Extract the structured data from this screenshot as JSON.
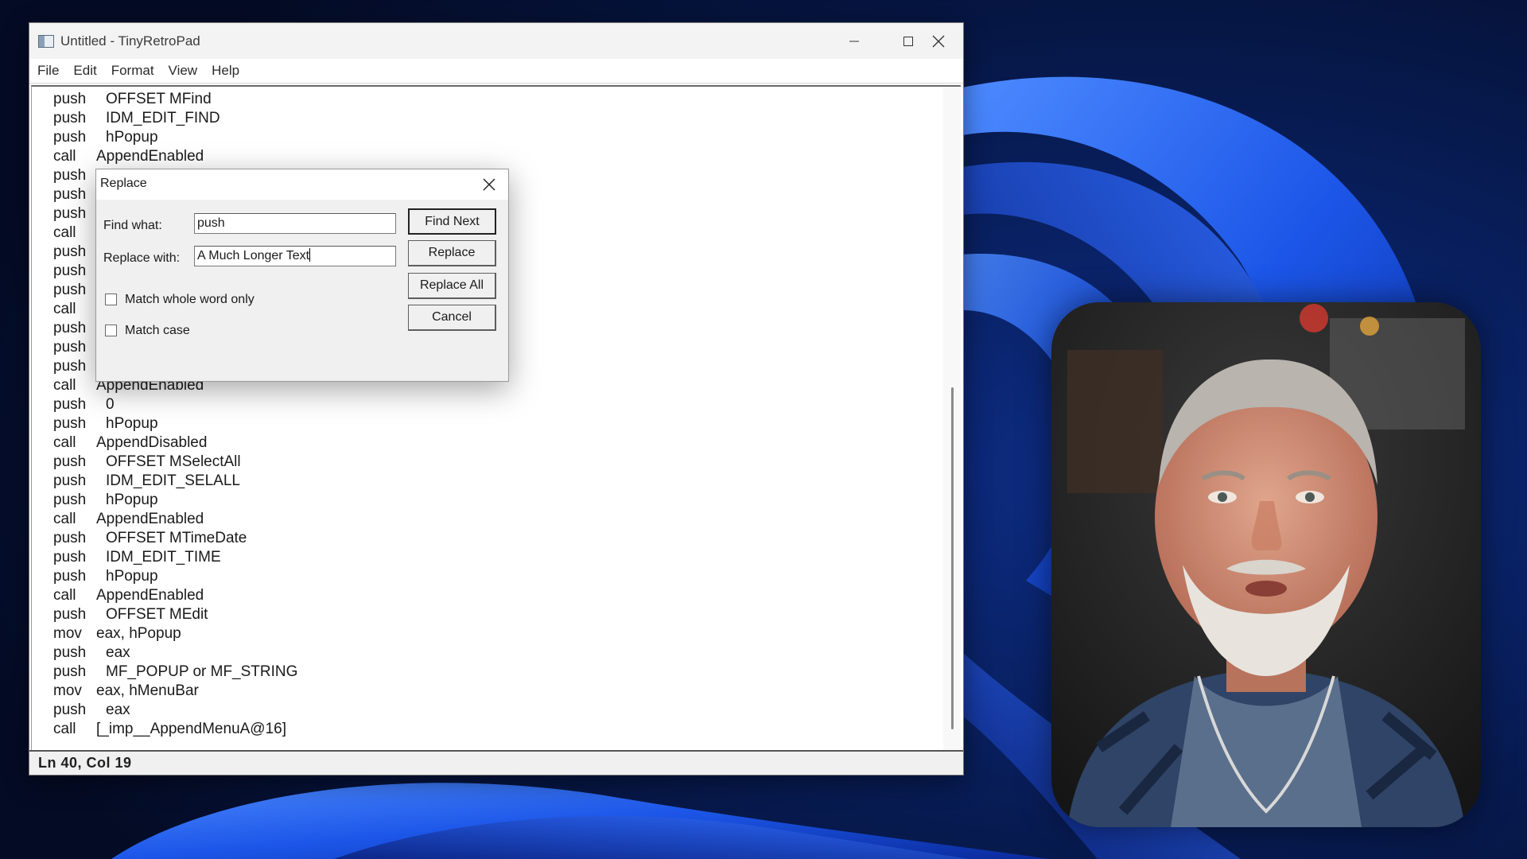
{
  "window": {
    "title": "Untitled - TinyRetroPad"
  },
  "menu": [
    "File",
    "Edit",
    "Format",
    "View",
    "Help"
  ],
  "editor": {
    "lines": [
      {
        "op": "push",
        "arg": "OFFSET MFind"
      },
      {
        "op": "push",
        "arg": "IDM_EDIT_FIND"
      },
      {
        "op": "push",
        "arg": "hPopup"
      },
      {
        "op": "call",
        "arg": "AppendEnabled"
      },
      {
        "op": "push",
        "arg": ""
      },
      {
        "op": "push",
        "arg": ""
      },
      {
        "op": "push",
        "arg": ""
      },
      {
        "op": "call",
        "arg": ""
      },
      {
        "op": "push",
        "arg": ""
      },
      {
        "op": "push",
        "arg": ""
      },
      {
        "op": "push",
        "arg": ""
      },
      {
        "op": "call",
        "arg": ""
      },
      {
        "op": "push",
        "arg": ""
      },
      {
        "op": "push",
        "arg": ""
      },
      {
        "op": "push",
        "arg": ""
      },
      {
        "op": "call",
        "arg": "AppendEnabled"
      },
      {
        "op": "push",
        "arg": "0"
      },
      {
        "op": "push",
        "arg": "hPopup"
      },
      {
        "op": "call",
        "arg": "AppendDisabled"
      },
      {
        "op": "push",
        "arg": "OFFSET MSelectAll"
      },
      {
        "op": "push",
        "arg": "IDM_EDIT_SELALL"
      },
      {
        "op": "push",
        "arg": "hPopup"
      },
      {
        "op": "call",
        "arg": "AppendEnabled"
      },
      {
        "op": "push",
        "arg": "OFFSET MTimeDate"
      },
      {
        "op": "push",
        "arg": "IDM_EDIT_TIME"
      },
      {
        "op": "push",
        "arg": "hPopup"
      },
      {
        "op": "call",
        "arg": "AppendEnabled"
      },
      {
        "op": "push",
        "arg": "OFFSET MEdit"
      },
      {
        "op": "mov",
        "arg": "eax, hPopup"
      },
      {
        "op": "push",
        "arg": "eax"
      },
      {
        "op": "push",
        "arg": "MF_POPUP or MF_STRING"
      },
      {
        "op": "mov",
        "arg": "eax, hMenuBar"
      },
      {
        "op": "push",
        "arg": "eax"
      },
      {
        "op": "call",
        "arg": "[_imp__AppendMenuA@16]"
      }
    ]
  },
  "status": "Ln 40, Col 19",
  "dialog": {
    "title": "Replace",
    "find_label": "Find what:",
    "find_value": "push",
    "replace_label": "Replace with:",
    "replace_value": "A Much Longer Text",
    "match_whole_word_label": "Match whole word only",
    "match_whole_word_checked": false,
    "match_case_label": "Match case",
    "match_case_checked": false,
    "buttons": {
      "find_next": "Find Next",
      "replace": "Replace",
      "replace_all": "Replace All",
      "cancel": "Cancel"
    }
  },
  "colors": {
    "desktop_bg": "#061233",
    "bloom_blue": "#1f5ff0"
  }
}
